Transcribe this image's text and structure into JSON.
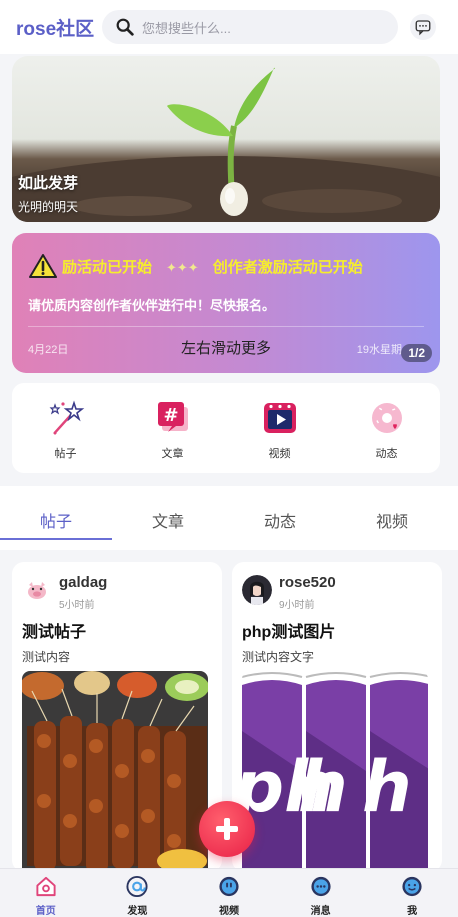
{
  "header": {
    "logo": "rose社区",
    "search_placeholder": "您想搜些什么...",
    "accent_color": "#5b5fc7"
  },
  "banner": {
    "title": "如此发芽",
    "subtitle": "光明的明天"
  },
  "notice": {
    "marquee_1": "励活动已开始",
    "marquee_sep": "✦✦✦",
    "marquee_2": "创作者激励活动已开始",
    "description": "请优质内容创作者伙伴进行中！尽快报名。",
    "date_left": "4月22日",
    "swipe_hint": "左右滑动更多",
    "date_right": "19水星期",
    "pager": "1/2"
  },
  "quick_nav": [
    {
      "label": "帖子",
      "icon": "magic-wand-icon"
    },
    {
      "label": "文章",
      "icon": "hashtag-icon"
    },
    {
      "label": "视频",
      "icon": "video-icon"
    },
    {
      "label": "动态",
      "icon": "donut-icon"
    }
  ],
  "tabs": [
    {
      "label": "帖子",
      "active": true
    },
    {
      "label": "文章",
      "active": false
    },
    {
      "label": "动态",
      "active": false
    },
    {
      "label": "视频",
      "active": false
    }
  ],
  "posts": [
    {
      "username": "galdag",
      "time": "5小时前",
      "title": "测试帖子",
      "content": "测试内容",
      "image": "skewers-photo"
    },
    {
      "username": "rose520",
      "time": "9小时前",
      "title": "php测试图片",
      "content": "测试内容文字",
      "image": "php-logo"
    }
  ],
  "bottom_nav": [
    {
      "label": "首页",
      "icon": "home-icon",
      "active": true
    },
    {
      "label": "发现",
      "icon": "at-icon",
      "active": false
    },
    {
      "label": "视频",
      "icon": "video-face-icon",
      "active": false
    },
    {
      "label": "消息",
      "icon": "message-face-icon",
      "active": false
    },
    {
      "label": "我",
      "icon": "user-face-icon",
      "active": false
    }
  ]
}
